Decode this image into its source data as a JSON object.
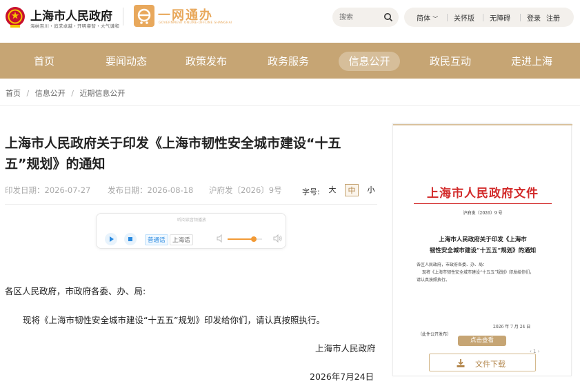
{
  "header": {
    "site_title": "上海市人民政府",
    "site_motto": "海纳百川・追求卓越・开明睿智・大气谦和",
    "yw_name": "一网通办",
    "yw_sub": "GOVERNMENT ONLINE-OFFLINE SHANGHAI",
    "search_placeholder": "搜索",
    "utils": [
      "简体",
      "关怀版",
      "无障碍",
      "登录",
      "注册"
    ]
  },
  "nav": {
    "items": [
      "首页",
      "要闻动态",
      "政策发布",
      "政务服务",
      "信息公开",
      "政民互动",
      "走进上海"
    ],
    "active": "信息公开"
  },
  "breadcrumb": [
    "首页",
    "信息公开",
    "近期信息公开"
  ],
  "article": {
    "title_line1": "上海市人民政府关于印发《上海市韧性安全城市建设“十五",
    "title_line2": "五”规划》的通知",
    "print_date": "印发日期：2026-07-27",
    "publish_date": "发布日期：2026-08-18",
    "doc_number": "沪府发〔2026〕9号",
    "font_label": "字号:",
    "font_sizes": [
      "大",
      "中",
      "小"
    ],
    "font_active": "中",
    "player_hint": "听阅读音频播放",
    "lang_options": [
      "普通话",
      "上海话"
    ],
    "volume_level": 0.75,
    "salutation": "各区人民政府，市政府各委、办、局:",
    "paragraph": "现将《上海市韧性安全城市建设“十五五”规划》印发给你们，请认真按照执行。",
    "signer": "上海市人民政府",
    "sign_date": "2026年7月24日"
  },
  "doc_panel": {
    "head": "上海市人民政府文件",
    "number": "沪府发〔2026〕9 号",
    "sub_line1": "上海市人民政府关于印发《上海市",
    "sub_line2": "韧性安全城市建设“十五五”规划》的通知",
    "line1": "各区人民政府，市政府各委、办、局：",
    "line2": "现将《上海市韧性安全城市建设“十五五”规划》印发给你们，",
    "line3": "请认真按照执行。",
    "date": "2026 年 7 月 24 日",
    "note": "（此件公开发布）",
    "view_label": "点击查看",
    "download_label": "文件下载",
    "pager": "1"
  },
  "colors": {
    "gold": "#c6a574",
    "red": "#d22a2a",
    "orange": "#e8a85c"
  }
}
